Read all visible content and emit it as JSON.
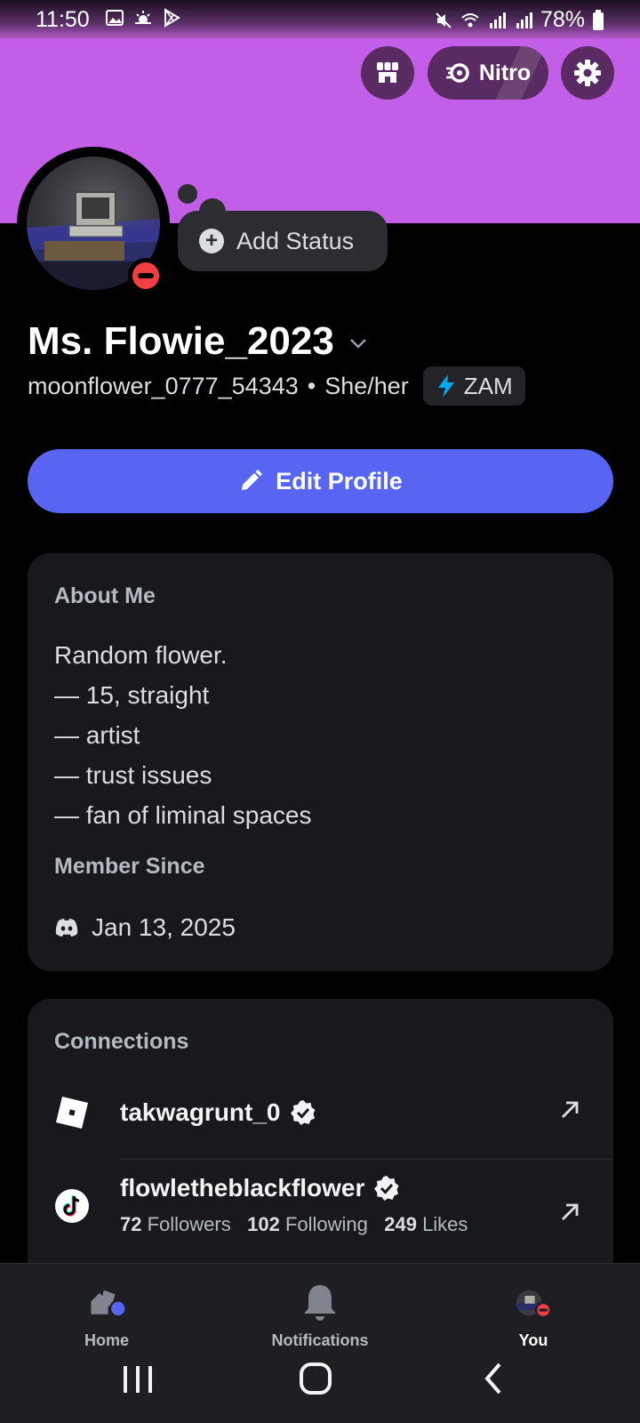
{
  "status_bar": {
    "time": "11:50",
    "battery": "78%",
    "left_icons": [
      "gallery-icon",
      "weather-icon",
      "play-store-icon"
    ],
    "right_icons": [
      "mute-icon",
      "wifi-icon",
      "signal-icon",
      "signal-icon",
      "battery-icon"
    ]
  },
  "header": {
    "nitro_label": "Nitro",
    "banner_color": "#c25ee8"
  },
  "profile": {
    "add_status_label": "Add Status",
    "display_name": "Ms. Flowie_2023",
    "username": "moonflower_0777_54343",
    "separator": "•",
    "pronouns": "She/her",
    "tag": "ZAM",
    "status": "dnd",
    "edit_label": "Edit Profile"
  },
  "about": {
    "title": "About Me",
    "lines": [
      "Random flower.",
      "— 15, straight",
      "— artist",
      "— trust issues",
      "— fan of liminal spaces"
    ],
    "member_since_title": "Member Since",
    "member_since": "Jan 13, 2025"
  },
  "connections": {
    "title": "Connections",
    "items": [
      {
        "service": "roblox",
        "name": "takwagrunt_0",
        "verified": true
      },
      {
        "service": "tiktok",
        "name": "flowletheblackflower",
        "verified": true,
        "followers": "72",
        "followers_label": "Followers",
        "following": "102",
        "following_label": "Following",
        "likes": "249",
        "likes_label": "Likes"
      }
    ]
  },
  "bottom_nav": {
    "items": [
      {
        "label": "Home"
      },
      {
        "label": "Notifications"
      },
      {
        "label": "You"
      }
    ]
  },
  "colors": {
    "accent": "#5865f2",
    "dnd": "#f23f43",
    "card": "#18191c"
  }
}
